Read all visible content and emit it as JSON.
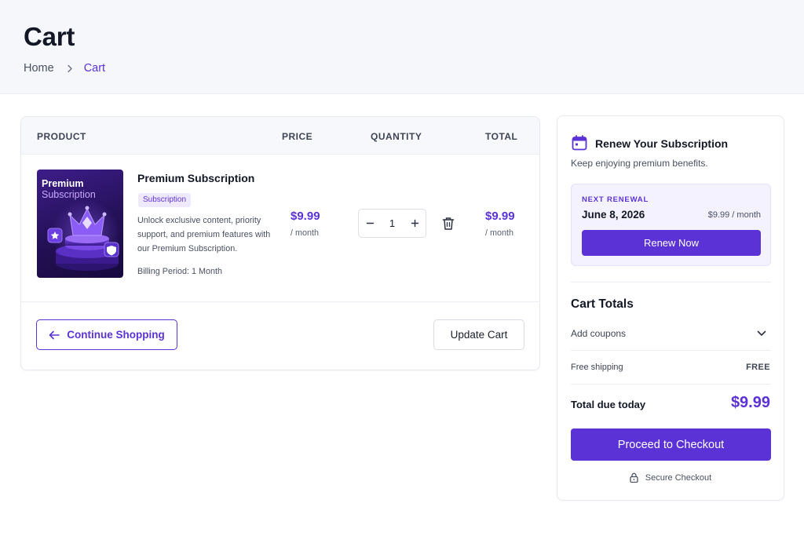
{
  "header": {
    "title": "Cart",
    "breadcrumb": {
      "home": "Home",
      "current": "Cart"
    }
  },
  "cart_table": {
    "columns": {
      "product": "PRODUCT",
      "price": "PRICE",
      "quantity": "QUANTITY",
      "total": "TOTAL"
    },
    "items": [
      {
        "image_title_line1": "Premium",
        "image_title_line2": "Subscription",
        "name": "Premium Subscription",
        "badge": "Subscription",
        "description": "Unlock exclusive content, priority support, and premium features with our Premium Subscription.",
        "billing": "Billing Period: 1 Month",
        "price": "$9.99",
        "price_unit": "/ month",
        "quantity": "1",
        "total": "$9.99",
        "total_unit": "/ month"
      }
    ],
    "continue_label": "Continue Shopping",
    "update_label": "Update Cart"
  },
  "renewal": {
    "title": "Renew Your Subscription",
    "subtitle": "Keep enjoying premium benefits.",
    "next_label": "NEXT RENEWAL",
    "date": "June 8, 2026",
    "price": "$9.99 / month",
    "button": "Renew Now"
  },
  "totals": {
    "title": "Cart Totals",
    "coupon_label": "Add coupons",
    "shipping_label": "Free shipping",
    "shipping_value": "FREE",
    "due_label": "Total due today",
    "due_value": "$9.99",
    "checkout_label": "Proceed to Checkout",
    "secure_label": "Secure Checkout"
  },
  "icons": {
    "breadcrumb_separator": "chevron-right-icon",
    "qty_decrease": "minus-icon",
    "qty_increase": "plus-icon",
    "remove": "trash-icon",
    "continue": "arrow-left-icon",
    "renewal": "calendar-icon",
    "coupon": "chevron-down-icon",
    "secure": "lock-icon"
  },
  "colors": {
    "accent": "#5b32d6",
    "header_bg": "#f6f7fb",
    "text_dark": "#141826",
    "text_muted": "#4a5063",
    "renew_box_bg": "#f4f2ff"
  }
}
